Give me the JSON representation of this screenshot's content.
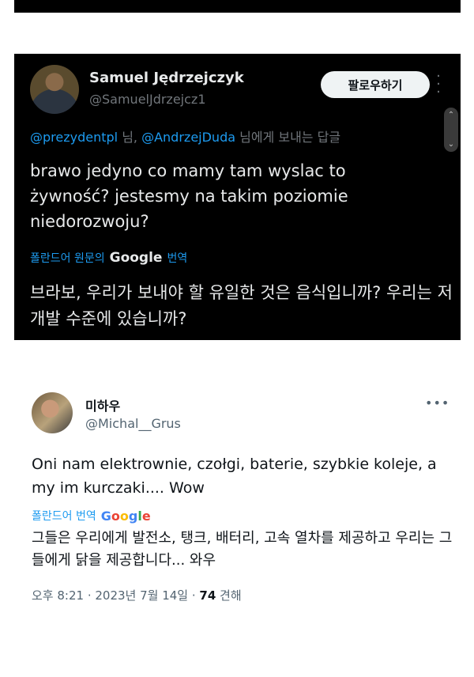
{
  "tweet1": {
    "display_name": "Samuel Jędrzejczyk",
    "handle": "@SamuelJdrzejcz1",
    "follow_label": "팔로우하기",
    "more_icon": "more-vertical-icon",
    "reply_mention1": "@prezydentpl",
    "reply_sep": " 님, ",
    "reply_mention2": "@AndrzejDuda",
    "reply_suffix": " 님에게 보내는 답글",
    "body": "brawo jedyno co mamy tam wyslac to żywność?  jestesmy na takim poziomie niedorozwoju?",
    "translate_prefix": "폴란드어 원문의",
    "translate_google": "Google",
    "translate_suffix": "번역",
    "translated": "브라보, 우리가 보내야 할 유일한 것은 음식입니까? 우리는 저개발 수준에 있습니까?"
  },
  "tweet2": {
    "display_name": "미하우",
    "handle": "@Michal__Grus",
    "more_icon": "more-horizontal-icon",
    "body": "Oni nam elektrownie, czołgi, baterie, szybkie koleje, a my im kurczaki.... Wow",
    "translate_label": "폴란드어 번역",
    "translate_google": "Google",
    "translated": "그들은 우리에게 발전소, 탱크, 배터리, 고속 열차를 제공하고 우리는 그들에게 닭을 제공합니다... 와우",
    "time": "오후 8:21 · 2023년 7월 14일 · ",
    "views_count": "74",
    "views_label": " 견해"
  },
  "colors": {
    "accent_blue": "#1d9bf0",
    "dark_bg": "#000000",
    "muted_text": "#71767b"
  }
}
